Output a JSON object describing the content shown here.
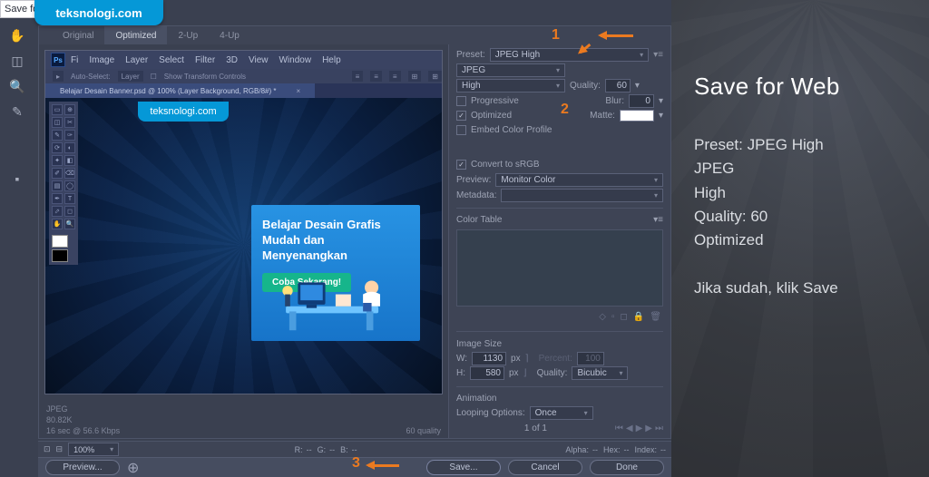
{
  "watermark": "teksnologi.com",
  "top_strip": "Save fo",
  "tabs": {
    "original": "Original",
    "optimized": "Optimized",
    "two": "2-Up",
    "four": "4-Up"
  },
  "ps_menu": [
    "Fi",
    "Image",
    "Layer",
    "Select",
    "Filter",
    "3D",
    "View",
    "Window",
    "Help"
  ],
  "ps_opt": {
    "auto": "Auto-Select:",
    "layer": "Layer",
    "show": "Show Transform Controls"
  },
  "ps_doc": "Belajar Desain Banner.psd @ 100% (Layer Background, RGB/8#) *",
  "banner": {
    "line1": "Belajar Desain Grafis",
    "line2": "Mudah dan Menyenangkan",
    "cta": "Coba Sekarang!"
  },
  "pv_info": {
    "fmt": "JPEG",
    "size": "80.82K",
    "time": "16 sec @ 56.6 Kbps",
    "q": "60 quality"
  },
  "preset_label": "Preset:",
  "preset": "JPEG High",
  "format": "JPEG",
  "comp": "High",
  "quality_label": "Quality:",
  "quality": "60",
  "progressive": "Progressive",
  "blur_label": "Blur:",
  "blur": "0",
  "optimized": "Optimized",
  "matte_label": "Matte:",
  "embed": "Embed Color Profile",
  "srgb": "Convert to sRGB",
  "preview_label": "Preview:",
  "preview_val": "Monitor Color",
  "metadata": "Metadata:",
  "colortable": "Color Table",
  "imgsize": "Image Size",
  "wlbl": "W:",
  "wval": "1130",
  "pct_label": "Percent:",
  "pct_val": "100",
  "hlbl": "H:",
  "hval": "580",
  "px": "px",
  "sz_quality": "Quality:",
  "bicubic": "Bicubic",
  "animation": "Animation",
  "loop_label": "Looping Options:",
  "loop_val": "Once",
  "footer": {
    "zoom": "100%",
    "R": "R:",
    "G": "G:",
    "B": "B:",
    "alpha": "Alpha:",
    "hex": "Hex:",
    "idx": "Index:",
    "dash": "--",
    "pages": "1 of 1"
  },
  "buttons": {
    "preview": "Preview...",
    "save": "Save...",
    "cancel": "Cancel",
    "done": "Done"
  },
  "ann": {
    "n1": "1",
    "n2": "2",
    "n3": "3"
  },
  "explain": {
    "title": "Save for Web",
    "lines": [
      "Preset: JPEG High",
      "JPEG",
      "High",
      "Quality: 60",
      "Optimized"
    ],
    "final": "Jika sudah, klik Save"
  }
}
